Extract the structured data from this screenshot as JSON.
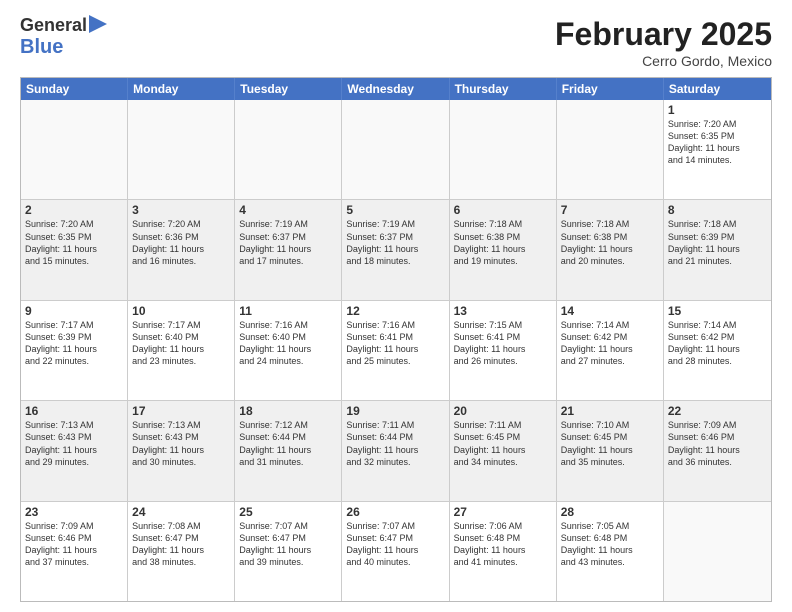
{
  "logo": {
    "line1": "General",
    "line2": "Blue"
  },
  "title": "February 2025",
  "subtitle": "Cerro Gordo, Mexico",
  "weekdays": [
    "Sunday",
    "Monday",
    "Tuesday",
    "Wednesday",
    "Thursday",
    "Friday",
    "Saturday"
  ],
  "rows": [
    [
      {
        "day": "",
        "info": ""
      },
      {
        "day": "",
        "info": ""
      },
      {
        "day": "",
        "info": ""
      },
      {
        "day": "",
        "info": ""
      },
      {
        "day": "",
        "info": ""
      },
      {
        "day": "",
        "info": ""
      },
      {
        "day": "1",
        "info": "Sunrise: 7:20 AM\nSunset: 6:35 PM\nDaylight: 11 hours\nand 14 minutes."
      }
    ],
    [
      {
        "day": "2",
        "info": "Sunrise: 7:20 AM\nSunset: 6:35 PM\nDaylight: 11 hours\nand 15 minutes."
      },
      {
        "day": "3",
        "info": "Sunrise: 7:20 AM\nSunset: 6:36 PM\nDaylight: 11 hours\nand 16 minutes."
      },
      {
        "day": "4",
        "info": "Sunrise: 7:19 AM\nSunset: 6:37 PM\nDaylight: 11 hours\nand 17 minutes."
      },
      {
        "day": "5",
        "info": "Sunrise: 7:19 AM\nSunset: 6:37 PM\nDaylight: 11 hours\nand 18 minutes."
      },
      {
        "day": "6",
        "info": "Sunrise: 7:18 AM\nSunset: 6:38 PM\nDaylight: 11 hours\nand 19 minutes."
      },
      {
        "day": "7",
        "info": "Sunrise: 7:18 AM\nSunset: 6:38 PM\nDaylight: 11 hours\nand 20 minutes."
      },
      {
        "day": "8",
        "info": "Sunrise: 7:18 AM\nSunset: 6:39 PM\nDaylight: 11 hours\nand 21 minutes."
      }
    ],
    [
      {
        "day": "9",
        "info": "Sunrise: 7:17 AM\nSunset: 6:39 PM\nDaylight: 11 hours\nand 22 minutes."
      },
      {
        "day": "10",
        "info": "Sunrise: 7:17 AM\nSunset: 6:40 PM\nDaylight: 11 hours\nand 23 minutes."
      },
      {
        "day": "11",
        "info": "Sunrise: 7:16 AM\nSunset: 6:40 PM\nDaylight: 11 hours\nand 24 minutes."
      },
      {
        "day": "12",
        "info": "Sunrise: 7:16 AM\nSunset: 6:41 PM\nDaylight: 11 hours\nand 25 minutes."
      },
      {
        "day": "13",
        "info": "Sunrise: 7:15 AM\nSunset: 6:41 PM\nDaylight: 11 hours\nand 26 minutes."
      },
      {
        "day": "14",
        "info": "Sunrise: 7:14 AM\nSunset: 6:42 PM\nDaylight: 11 hours\nand 27 minutes."
      },
      {
        "day": "15",
        "info": "Sunrise: 7:14 AM\nSunset: 6:42 PM\nDaylight: 11 hours\nand 28 minutes."
      }
    ],
    [
      {
        "day": "16",
        "info": "Sunrise: 7:13 AM\nSunset: 6:43 PM\nDaylight: 11 hours\nand 29 minutes."
      },
      {
        "day": "17",
        "info": "Sunrise: 7:13 AM\nSunset: 6:43 PM\nDaylight: 11 hours\nand 30 minutes."
      },
      {
        "day": "18",
        "info": "Sunrise: 7:12 AM\nSunset: 6:44 PM\nDaylight: 11 hours\nand 31 minutes."
      },
      {
        "day": "19",
        "info": "Sunrise: 7:11 AM\nSunset: 6:44 PM\nDaylight: 11 hours\nand 32 minutes."
      },
      {
        "day": "20",
        "info": "Sunrise: 7:11 AM\nSunset: 6:45 PM\nDaylight: 11 hours\nand 34 minutes."
      },
      {
        "day": "21",
        "info": "Sunrise: 7:10 AM\nSunset: 6:45 PM\nDaylight: 11 hours\nand 35 minutes."
      },
      {
        "day": "22",
        "info": "Sunrise: 7:09 AM\nSunset: 6:46 PM\nDaylight: 11 hours\nand 36 minutes."
      }
    ],
    [
      {
        "day": "23",
        "info": "Sunrise: 7:09 AM\nSunset: 6:46 PM\nDaylight: 11 hours\nand 37 minutes."
      },
      {
        "day": "24",
        "info": "Sunrise: 7:08 AM\nSunset: 6:47 PM\nDaylight: 11 hours\nand 38 minutes."
      },
      {
        "day": "25",
        "info": "Sunrise: 7:07 AM\nSunset: 6:47 PM\nDaylight: 11 hours\nand 39 minutes."
      },
      {
        "day": "26",
        "info": "Sunrise: 7:07 AM\nSunset: 6:47 PM\nDaylight: 11 hours\nand 40 minutes."
      },
      {
        "day": "27",
        "info": "Sunrise: 7:06 AM\nSunset: 6:48 PM\nDaylight: 11 hours\nand 41 minutes."
      },
      {
        "day": "28",
        "info": "Sunrise: 7:05 AM\nSunset: 6:48 PM\nDaylight: 11 hours\nand 43 minutes."
      },
      {
        "day": "",
        "info": ""
      }
    ]
  ]
}
